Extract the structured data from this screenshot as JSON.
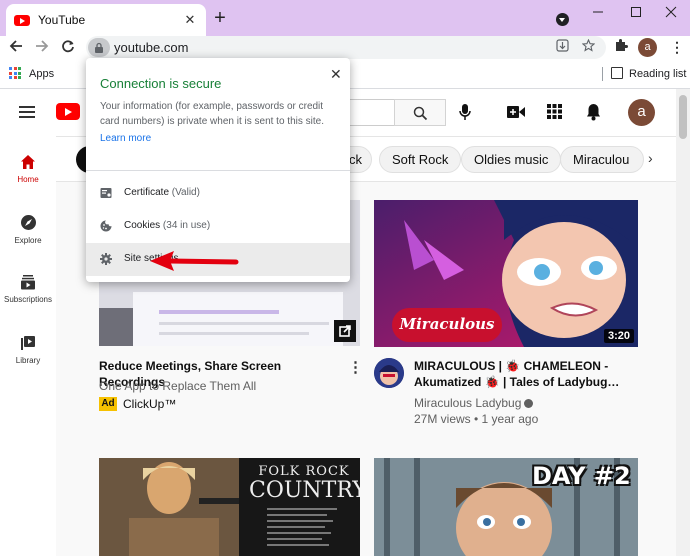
{
  "browser": {
    "tab_title": "YouTube",
    "tab_close": "✕",
    "new_tab": "+",
    "url": "youtube.com",
    "profile_initial": "a",
    "bookmarks": {
      "apps_label": "Apps",
      "reading_list_label": "Reading list"
    }
  },
  "popup": {
    "title": "Connection is secure",
    "description": "Your information (for example, passwords or credit card numbers) is private when it is sent to this site.",
    "learn_more": "Learn more",
    "close": "✕",
    "items": [
      {
        "label": "Certificate",
        "sub": "(Valid)",
        "icon": "certificate-icon"
      },
      {
        "label": "Cookies",
        "sub": "(34 in use)",
        "icon": "cookie-icon"
      },
      {
        "label": "Site settings",
        "sub": "",
        "icon": "gear-icon"
      }
    ]
  },
  "youtube": {
    "avatar_initial": "a",
    "sidebar": [
      {
        "label": "Home",
        "icon": "home-icon"
      },
      {
        "label": "Explore",
        "icon": "compass-icon"
      },
      {
        "label": "Subscriptions",
        "icon": "subscriptions-icon"
      },
      {
        "label": "Library",
        "icon": "library-icon"
      }
    ],
    "chips": [
      "ck",
      "Soft Rock",
      "Oldies music",
      "Miraculou"
    ],
    "chip_next": "›",
    "videos": [
      {
        "title": "Reduce Meetings, Share Screen Recordings",
        "subtitle": "One App to Replace Them All",
        "badge": "Ad",
        "channel": "ClickUp™"
      },
      {
        "title_line1": "MIRACULOUS | 🐞 CHAMELEON -",
        "title_line2": "Akumatized 🐞 | Tales of Ladybug…",
        "channel": "Miraculous Ladybug",
        "stats": "27M views • 1 year ago",
        "duration": "3:20",
        "thumb_text": "Miraculous"
      },
      {
        "thumb_text_1": "FOLK ROCK",
        "thumb_text_2": "COUNTRY"
      },
      {
        "thumb_text": "DAY #2"
      }
    ]
  }
}
